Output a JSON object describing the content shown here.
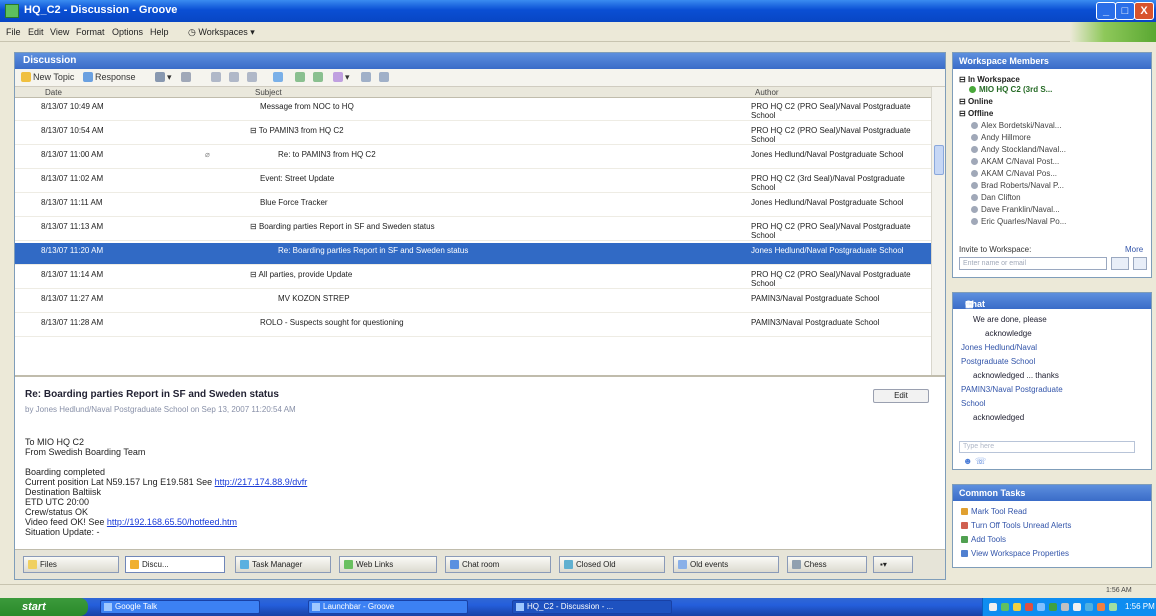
{
  "window": {
    "title": "HQ_C2 - Discussion - Groove",
    "minimize": "_",
    "maximize": "□",
    "close": "X"
  },
  "menu": [
    "File",
    "Edit",
    "View",
    "Format",
    "Options",
    "Help",
    "Workspaces"
  ],
  "discussion": {
    "header": "Discussion",
    "toolbar": {
      "new_topic": "New Topic",
      "response": "Response"
    },
    "columns": {
      "date": "Date",
      "subject": "Subject",
      "author": "Author"
    },
    "rows": [
      {
        "date": "8/13/07 10:49 AM",
        "attach": "",
        "subject": "Message from NOC to HQ",
        "author": "PRO HQ C2 (PRO Seal)/Naval Postgraduate School"
      },
      {
        "date": "8/13/07 10:54 AM",
        "attach": "",
        "subject": "To PAMIN3 from HQ C2",
        "author": "PRO HQ C2 (PRO Seal)/Naval Postgraduate School"
      },
      {
        "date": "8/13/07 11:00 AM",
        "attach": "⌀",
        "subject": "Re: to PAMIN3 from HQ C2",
        "author": "Jones Hedlund/Naval Postgraduate School"
      },
      {
        "date": "8/13/07 11:02 AM",
        "attach": "",
        "subject": "Event: Street Update",
        "author": "PRO HQ C2 (3rd Seal)/Naval Postgraduate School"
      },
      {
        "date": "8/13/07 11:11 AM",
        "attach": "",
        "subject": "Blue Force Tracker",
        "author": "Jones Hedlund/Naval Postgraduate School"
      },
      {
        "date": "8/13/07 11:13 AM",
        "attach": "",
        "subject": "Boarding parties Report in SF and Sweden status",
        "author": "PRO HQ C2 (PRO Seal)/Naval Postgraduate School"
      },
      {
        "date": "8/13/07 11:20 AM",
        "attach": "",
        "subject": "Re: Boarding parties Report in SF and Sweden status",
        "author": "Jones Hedlund/Naval Postgraduate School",
        "selected": true
      },
      {
        "date": "8/13/07 11:14 AM",
        "attach": "",
        "subject": "All parties, provide Update",
        "author": "PRO HQ C2 (PRO Seal)/Naval Postgraduate School"
      },
      {
        "date": "8/13/07 11:27 AM",
        "attach": "",
        "subject": "MV KOZON STREP",
        "author": "PAMIN3/Naval Postgraduate School"
      },
      {
        "date": "8/13/07 11:28 AM",
        "attach": "",
        "subject": "ROLO - Suspects sought for questioning",
        "author": "PAMIN3/Naval Postgraduate School"
      }
    ],
    "preview": {
      "subject": "Re: Boarding parties Report in SF and Sweden status",
      "meta": "by Jones Hedlund/Naval Postgraduate School on Sep 13, 2007 11:20:54 AM",
      "edit": "Edit",
      "lines": [
        "To MIO HQ C2",
        "From Swedish Boarding Team",
        "",
        "Boarding completed",
        "Current position Lat N59.157  Lng E19.581  See ",
        "Destination Baltiisk",
        "ETD UTC 20:00",
        "Crew/status OK",
        "Video feed OK! See ",
        "Situation Update: -"
      ],
      "link1": "http://217.174.88.9/dvfr",
      "link2": "http://192.168.65.50/hotfeed.htm"
    }
  },
  "tabs": [
    "Files",
    "Discu...",
    "Task Manager",
    "Web Links",
    "Chat room",
    "Closed Old",
    "Old events",
    "Chess"
  ],
  "members": {
    "header": "Workspace Members",
    "in_workspace_label": "In Workspace",
    "in_workspace": [
      "MIO HQ C2 (3rd S..."
    ],
    "online_label": "Online",
    "offline_label": "Offline",
    "offline": [
      "Alex Bordetski/Naval...",
      "Andy Hillmore",
      "Andy Stockland/Naval...",
      "AKAM C/Naval Post...",
      "AKAM C/Naval Pos...",
      "Brad Roberts/Naval P...",
      "Dan Clifton",
      "Dave Franklin/Naval...",
      "Eric Quarles/Naval Po..."
    ],
    "invite_label": "Invite to Workspace:",
    "invite_more": "More",
    "invite_placeholder": "Enter name or email"
  },
  "chat": {
    "header": "Chat",
    "lines": [
      "We are done, please",
      "acknowledge",
      "Jones Hedlund/Naval",
      "Postgraduate School",
      "acknowledged ... thanks",
      "PAMIN3/Naval Postgraduate",
      "School",
      "acknowledged"
    ],
    "input_placeholder": "Type here"
  },
  "common_tasks": {
    "header": "Common Tasks",
    "items": [
      "Mark Tool Read",
      "Turn Off Tools Unread Alerts",
      "Add Tools",
      "View Workspace Properties"
    ]
  },
  "statusbar": {
    "right": "1:56 AM"
  },
  "taskbar": {
    "start": "start",
    "tasks": [
      "Google Talk",
      "Launchbar - Groove",
      "HQ_C2 - Discussion - ..."
    ],
    "clock": "1:56 PM"
  },
  "colors": {
    "titlebar": "#0a4fd4",
    "selection": "#316ac5",
    "panel_header": "#4a7cd8"
  }
}
